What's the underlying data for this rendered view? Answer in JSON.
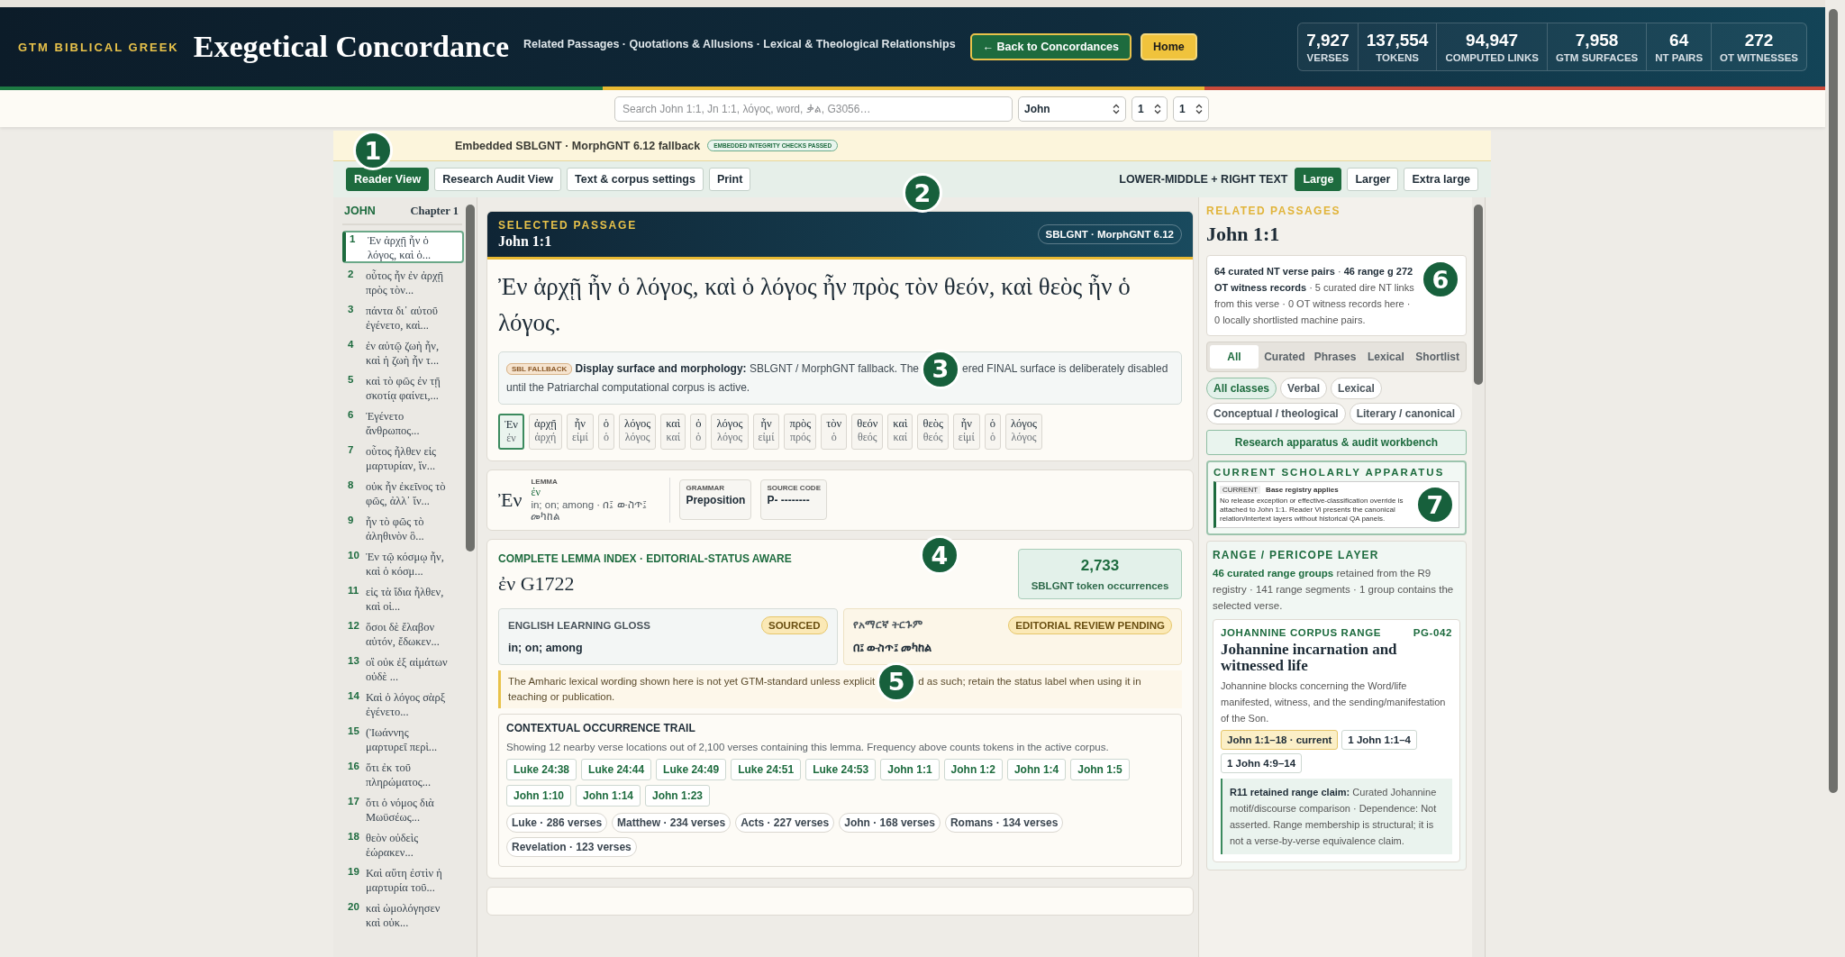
{
  "header": {
    "eyebrow": "GTM BIBLICAL GREEK",
    "title": "Exegetical Concordance",
    "subtitle": "Related Passages · Quotations & Allusions · Lexical & Theological Relationships",
    "buttons": [
      {
        "label": "← Back to Concordances",
        "kind": "primary"
      },
      {
        "label": "Home",
        "kind": "accent"
      }
    ],
    "stats": [
      {
        "value": "7,927",
        "label": "VERSES"
      },
      {
        "value": "137,554",
        "label": "TOKENS"
      },
      {
        "value": "94,947",
        "label": "COMPUTED LINKS"
      },
      {
        "value": "7,958",
        "label": "GTM SURFACES"
      },
      {
        "value": "64",
        "label": "NT PAIRS"
      },
      {
        "value": "272",
        "label": "OT WITNESSES"
      }
    ]
  },
  "search": {
    "placeholder": "Search John 1:1, Jn 1:1, λόγος, word, ቃል, G3056…",
    "book": "John",
    "chapter": "1",
    "verse": "1"
  },
  "source_bar": {
    "text": "Embedded SBLGNT · MorphGNT 6.12 fallback",
    "badge": "EMBEDDED INTEGRITY CHECKS PASSED"
  },
  "toolbar": {
    "views": [
      {
        "label": "Reader View",
        "selected": true
      },
      {
        "label": "Research Audit View",
        "selected": false
      },
      {
        "label": "Text & corpus settings",
        "selected": false
      },
      {
        "label": "Print",
        "selected": false
      }
    ],
    "size_label": "LOWER-MIDDLE + RIGHT TEXT",
    "sizes": [
      {
        "label": "Large",
        "selected": true
      },
      {
        "label": "Larger",
        "selected": false
      },
      {
        "label": "Extra large",
        "selected": false
      }
    ]
  },
  "annotations": [
    "1",
    "2",
    "3",
    "4",
    "5",
    "6",
    "7"
  ],
  "sidebar": {
    "book": "JOHN",
    "chapter": "Chapter 1",
    "verses": [
      {
        "number": "1",
        "text": "Ἐν ἀρχῇ ἦν ὁ λόγος, καὶ ὁ...",
        "selected": true
      },
      {
        "number": "2",
        "text": "οὗτος ἦν ἐν ἀρχῇ πρὸς τὸν...",
        "selected": false
      },
      {
        "number": "3",
        "text": "πάντα δι᾽ αὐτοῦ ἐγένετο, καὶ...",
        "selected": false
      },
      {
        "number": "4",
        "text": "ἐν αὐτῷ ζωὴ ἦν, καὶ ἡ ζωὴ ἦν τ...",
        "selected": false
      },
      {
        "number": "5",
        "text": "καὶ τὸ φῶς ἐν τῇ σκοτίᾳ φαίνει,...",
        "selected": false
      },
      {
        "number": "6",
        "text": "Ἐγένετο ἄνθρωπος...",
        "selected": false
      },
      {
        "number": "7",
        "text": "οὗτος ἦλθεν εἰς μαρτυρίαν, ἵν...",
        "selected": false
      },
      {
        "number": "8",
        "text": "οὐκ ἦν ἐκεῖνος τὸ φῶς, ἀλλ᾽ ἵν...",
        "selected": false
      },
      {
        "number": "9",
        "text": "ἦν τὸ φῶς τὸ ἀληθινὸν ὃ...",
        "selected": false
      },
      {
        "number": "10",
        "text": "Ἐν τῷ κόσμῳ ἦν, καὶ ὁ κόσμ...",
        "selected": false
      },
      {
        "number": "11",
        "text": "εἰς τὰ ἴδια ἦλθεν, καὶ οἱ...",
        "selected": false
      },
      {
        "number": "12",
        "text": "ὅσοι δὲ ἔλαβον αὐτόν, ἔδωκεν...",
        "selected": false
      },
      {
        "number": "13",
        "text": "οἳ οὐκ ἐξ αἱμάτων οὐδὲ ...",
        "selected": false
      },
      {
        "number": "14",
        "text": "Καὶ ὁ λόγος σὰρξ ἐγένετο...",
        "selected": false
      },
      {
        "number": "15",
        "text": "(Ἰωάννης μαρτυρεῖ περὶ...",
        "selected": false
      },
      {
        "number": "16",
        "text": "ὅτι ἐκ τοῦ πληρώματος...",
        "selected": false
      },
      {
        "number": "17",
        "text": "ὅτι ὁ νόμος διὰ Μωϋσέως...",
        "selected": false
      },
      {
        "number": "18",
        "text": "θεὸν οὐδεὶς ἑώρακεν...",
        "selected": false
      },
      {
        "number": "19",
        "text": "Καὶ αὕτη ἐστὶν ἡ μαρτυρία τοῦ...",
        "selected": false
      },
      {
        "number": "20",
        "text": "καὶ ὡμολόγησεν καὶ οὐκ...",
        "selected": false
      }
    ]
  },
  "passage": {
    "eyebrow": "SELECTED PASSAGE",
    "reference": "John 1:1",
    "edition": "SBLGNT · MorphGNT 6.12",
    "text": "Ἐν ἀρχῇ ἦν ὁ λόγος, καὶ ὁ λόγος ἦν πρὸς τὸν θεόν, καὶ θεὸς ἦν ὁ λόγος.",
    "note": {
      "badge": "SBL FALLBACK",
      "lead": "Display surface and morphology:",
      "text_parts": [
        "SBLGNT / MorphGNT fallback. The",
        "ered FINAL surface is deliberately disabled until the Patriarchal computational corpus is active."
      ]
    },
    "tokens": [
      {
        "surface": "Ἐν",
        "lemma": "ἐν",
        "selected": true
      },
      {
        "surface": "ἀρχῇ",
        "lemma": "ἀρχή",
        "selected": false
      },
      {
        "surface": "ἦν",
        "lemma": "εἰμί",
        "selected": false
      },
      {
        "surface": "ὁ",
        "lemma": "ὁ",
        "selected": false
      },
      {
        "surface": "λόγος",
        "lemma": "λόγος",
        "selected": false
      },
      {
        "surface": "καὶ",
        "lemma": "καί",
        "selected": false
      },
      {
        "surface": "ὁ",
        "lemma": "ὁ",
        "selected": false
      },
      {
        "surface": "λόγος",
        "lemma": "λόγος",
        "selected": false
      },
      {
        "surface": "ἦν",
        "lemma": "εἰμί",
        "selected": false
      },
      {
        "surface": "πρὸς",
        "lemma": "πρός",
        "selected": false
      },
      {
        "surface": "τὸν",
        "lemma": "ὁ",
        "selected": false
      },
      {
        "surface": "θεόν",
        "lemma": "θεός",
        "selected": false
      },
      {
        "surface": "καὶ",
        "lemma": "καί",
        "selected": false
      },
      {
        "surface": "θεὸς",
        "lemma": "θεός",
        "selected": false
      },
      {
        "surface": "ἦν",
        "lemma": "εἰμί",
        "selected": false
      },
      {
        "surface": "ὁ",
        "lemma": "ὁ",
        "selected": false
      },
      {
        "surface": "λόγος",
        "lemma": "λόγος",
        "selected": false
      }
    ]
  },
  "word": {
    "surface": "Ἐν",
    "lemma_label": "LEMMA",
    "lemma": "ἐν",
    "gloss": "in; on; among · በ፤ ውስጥ፤ መካከል",
    "fields": [
      {
        "label": "GRAMMAR",
        "value": "Preposition"
      },
      {
        "label": "SOURCE CODE",
        "value": "P- --------"
      }
    ]
  },
  "lemma_index": {
    "eyebrow": "COMPLETE LEMMA INDEX · EDITORIAL-STATUS AWARE",
    "headword": "ἐν G1722",
    "count": "2,733",
    "count_label": "SBLGNT token occurrences",
    "glosses": [
      {
        "kind": "english",
        "label": "ENGLISH LEARNING GLOSS",
        "status": "SOURCED",
        "value": "in; on; among"
      },
      {
        "kind": "amharic",
        "label": "የአማርኛ ትርጉም",
        "status": "EDITORIAL REVIEW PENDING",
        "value": "በ፤ ውስጥ፤ መካከል"
      }
    ],
    "note_parts": [
      "The Amharic lexical wording shown here is not yet GTM-standard unless explicit",
      "d as such; retain the status label when using it in teaching or publication."
    ],
    "trail": {
      "title": "CONTEXTUAL OCCURRENCE TRAIL",
      "description": "Showing 12 nearby verse locations out of 2,100 verses containing this lemma. Frequency above counts tokens in the active corpus.",
      "verses": [
        "Luke 24:38",
        "Luke 24:44",
        "Luke 24:49",
        "Luke 24:51",
        "Luke 24:53",
        "John 1:1",
        "John 1:2",
        "John 1:4",
        "John 1:5",
        "John 1:10",
        "John 1:14",
        "John 1:23"
      ],
      "books": [
        "Luke · 286 verses",
        "Matthew · 234 verses",
        "Acts · 227 verses",
        "John · 168 verses",
        "Romans · 134 verses",
        "Revelation · 123 verses"
      ]
    }
  },
  "related": {
    "eyebrow": "RELATED PASSAGES",
    "reference": "John 1:1",
    "summary": "**64 curated NT verse pairs** · **46 range g** **272 OT witness records** · 5 curated dire NT links from this verse · 0 OT witness records here · 0 locally shortlisted machine pairs.",
    "filters": [
      {
        "label": "All",
        "selected": true
      },
      {
        "label": "Curated",
        "selected": false
      },
      {
        "label": "Phrases",
        "selected": false
      },
      {
        "label": "Lexical",
        "selected": false
      },
      {
        "label": "Shortlist",
        "selected": false
      }
    ],
    "classes": [
      {
        "label": "All classes",
        "selected": true
      },
      {
        "label": "Verbal",
        "selected": false
      },
      {
        "label": "Lexical",
        "selected": false
      },
      {
        "label": "Conceptual / theological",
        "selected": false
      },
      {
        "label": "Literary / canonical",
        "selected": false
      }
    ],
    "workbench_button": "Research apparatus & audit workbench",
    "apparatus": {
      "title": "CURRENT SCHOLARLY APPARATUS",
      "badge": "CURRENT",
      "heading": "Base registry applies",
      "text_parts": [
        "No release exception or effective-classification override is attached to John 1:1. Reader Vi",
        "presents the canonical relation/intertext layers without historical QA panels."
      ]
    },
    "range_layer": {
      "title": "RANGE / PERICOPE LAYER",
      "summary": "**46 curated range groups** retained from the R9 registry · 141 range segments · 1 group contains the selected verse.",
      "group": {
        "eyebrow": "JOHANNINE CORPUS RANGE",
        "code": "PG-042",
        "title": "Johannine incarnation and witnessed life",
        "description": "Johannine blocks concerning the Word/life manifested, witness, and the sending/manifestation of the Son.",
        "ranges": [
          {
            "label": "John 1:1–18 · current",
            "selected": true
          },
          {
            "label": "1 John 1:1–4",
            "selected": false
          },
          {
            "label": "1 John 4:9–14",
            "selected": false
          }
        ],
        "claim": "**R11 retained range claim:** Curated Johannine motif/discourse comparison · Dependence: Not asserted. Range membership is structural; it is not a verse-by-verse equivalence claim."
      }
    }
  }
}
